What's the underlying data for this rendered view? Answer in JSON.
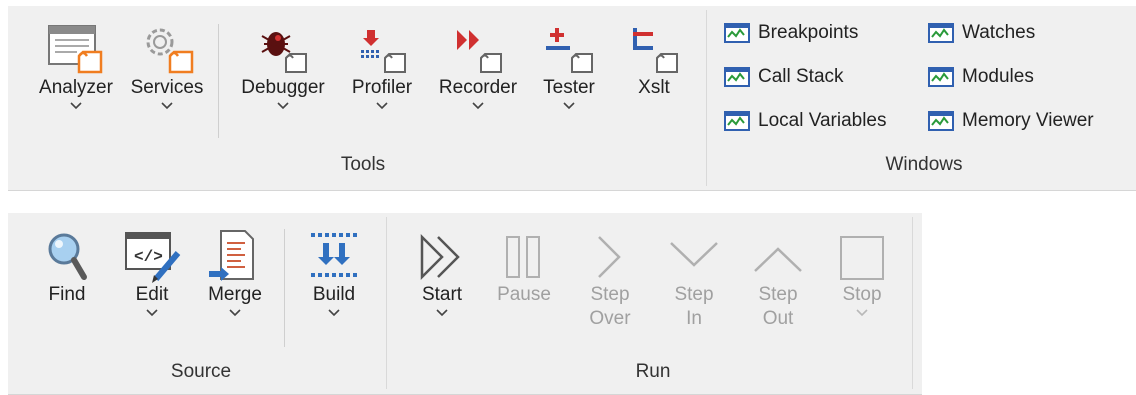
{
  "tools_ribbon": {
    "buttons": [
      {
        "label": "Analyzer",
        "icon": "analyzer-icon"
      },
      {
        "label": "Services",
        "icon": "services-icon"
      },
      {
        "label": "Debugger",
        "icon": "debugger-icon"
      },
      {
        "label": "Profiler",
        "icon": "profiler-icon"
      },
      {
        "label": "Recorder",
        "icon": "recorder-icon"
      },
      {
        "label": "Tester",
        "icon": "tester-icon"
      },
      {
        "label": "Xslt",
        "icon": "xslt-icon"
      }
    ],
    "group_label": "Tools",
    "windows": [
      {
        "label": "Breakpoints"
      },
      {
        "label": "Call Stack"
      },
      {
        "label": "Local Variables"
      },
      {
        "label": "Watches"
      },
      {
        "label": "Modules"
      },
      {
        "label": "Memory Viewer"
      }
    ],
    "windows_group_label": "Windows"
  },
  "source_run_ribbon": {
    "source": [
      {
        "label": "Find",
        "icon": "magnifier-icon"
      },
      {
        "label": "Edit",
        "icon": "code-edit-icon"
      },
      {
        "label": "Merge",
        "icon": "merge-icon"
      },
      {
        "label": "Build",
        "icon": "build-icon"
      }
    ],
    "source_group_label": "Source",
    "run": [
      {
        "label": "Start",
        "line2": "",
        "icon": "start-icon",
        "enabled": true
      },
      {
        "label": "Pause",
        "line2": "",
        "icon": "pause-icon",
        "enabled": false
      },
      {
        "label": "Step",
        "line2": "Over",
        "icon": "step-over-icon",
        "enabled": false
      },
      {
        "label": "Step",
        "line2": "In",
        "icon": "step-in-icon",
        "enabled": false
      },
      {
        "label": "Step",
        "line2": "Out",
        "icon": "step-out-icon",
        "enabled": false
      },
      {
        "label": "Stop",
        "line2": "",
        "icon": "stop-icon",
        "enabled": false
      }
    ],
    "run_group_label": "Run"
  },
  "colors": {
    "ribbon_bg": "#f0f0f0",
    "disabled_text": "#a0a0a0",
    "accent_orange": "#f07d20",
    "accent_red": "#d03030"
  }
}
